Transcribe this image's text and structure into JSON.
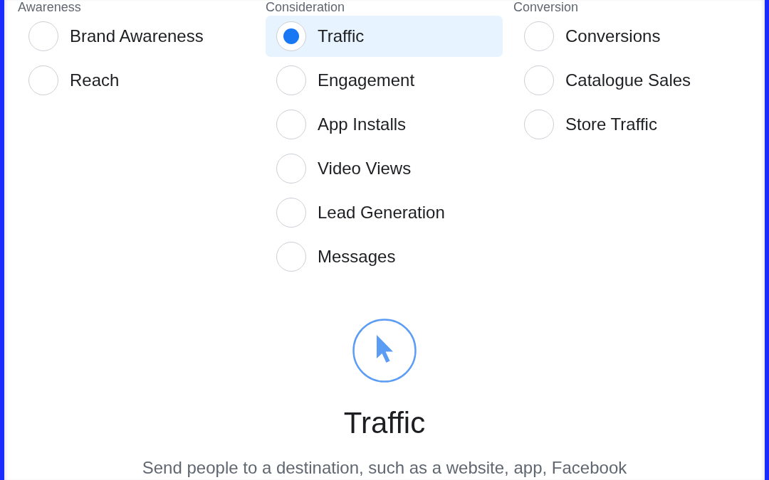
{
  "columns": [
    {
      "heading": "Awareness",
      "options": [
        {
          "label": "Brand Awareness",
          "selected": false
        },
        {
          "label": "Reach",
          "selected": false
        }
      ]
    },
    {
      "heading": "Consideration",
      "options": [
        {
          "label": "Traffic",
          "selected": true
        },
        {
          "label": "Engagement",
          "selected": false
        },
        {
          "label": "App Installs",
          "selected": false
        },
        {
          "label": "Video Views",
          "selected": false
        },
        {
          "label": "Lead Generation",
          "selected": false
        },
        {
          "label": "Messages",
          "selected": false
        }
      ]
    },
    {
      "heading": "Conversion",
      "options": [
        {
          "label": "Conversions",
          "selected": false
        },
        {
          "label": "Catalogue Sales",
          "selected": false
        },
        {
          "label": "Store Traffic",
          "selected": false
        }
      ]
    }
  ],
  "detail": {
    "title": "Traffic",
    "description": "Send people to a destination, such as a website, app, Facebook"
  }
}
